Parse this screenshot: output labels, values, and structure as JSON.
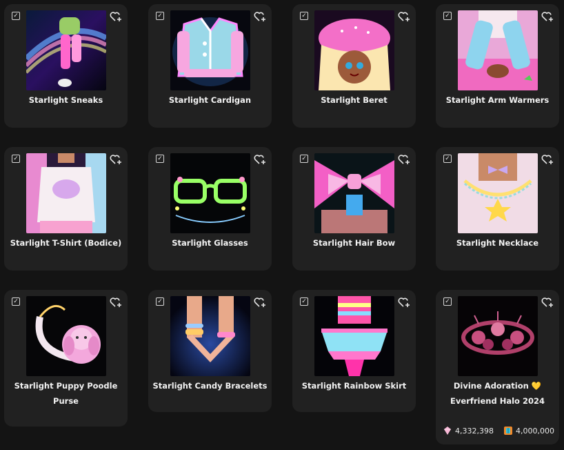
{
  "items": [
    {
      "name": "Starlight Sneaks"
    },
    {
      "name": "Starlight Cardigan"
    },
    {
      "name": "Starlight Beret"
    },
    {
      "name": "Starlight Arm Warmers"
    },
    {
      "name": "Starlight T-Shirt (Bodice)"
    },
    {
      "name": "Starlight Glasses"
    },
    {
      "name": "Starlight Hair Bow"
    },
    {
      "name": "Starlight Necklace"
    },
    {
      "name": "Starlight Puppy Poodle Purse"
    },
    {
      "name": "Starlight Candy Bracelets"
    },
    {
      "name": "Starlight Rainbow Skirt"
    },
    {
      "name": "Divine Adoration 💛 Everfriend Halo 2024",
      "price_primary": "4,332,398",
      "price_secondary": "4,000,000"
    }
  ],
  "icons": {
    "select": "checkbox-checked-icon",
    "favorite": "heart-plus-icon",
    "currency_primary": "pink-diamond-icon",
    "currency_secondary": "halo-token-icon"
  },
  "colors": {
    "background": "#141414",
    "card": "#212121",
    "text": "#f2f2f2"
  }
}
